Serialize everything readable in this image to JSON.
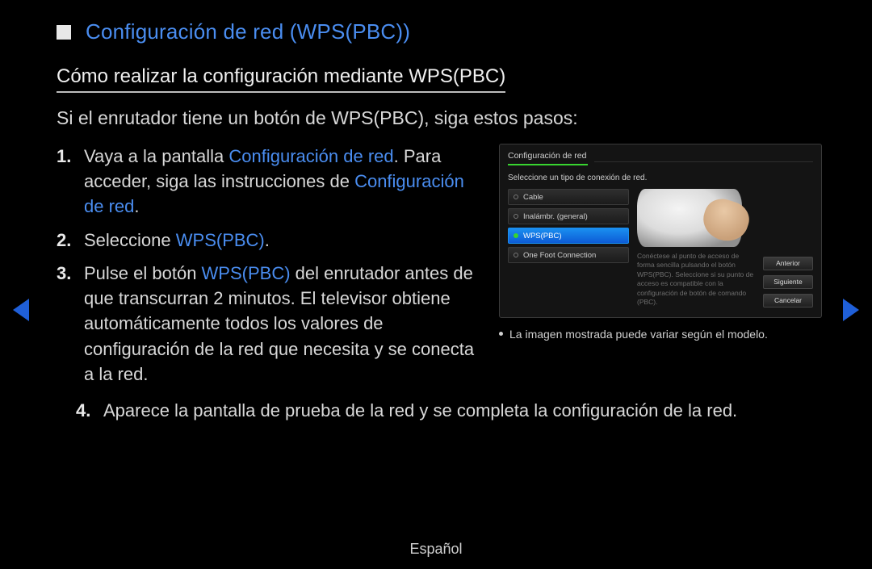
{
  "title": {
    "prefix": "Configuración de red (",
    "emph": "WPS(PBC)",
    "suffix": ")"
  },
  "subtitle": "Cómo realizar la configuración mediante WPS(PBC)",
  "intro": "Si el enrutador tiene un botón de WPS(PBC), siga estos pasos:",
  "steps": {
    "s1": {
      "num": "1.",
      "t1": "Vaya a la pantalla ",
      "e1": "Configuración de red",
      "t2": ". Para acceder, siga las instrucciones de ",
      "e2": "Configuración de red",
      "t3": "."
    },
    "s2": {
      "num": "2.",
      "t1": "Seleccione ",
      "e1": "WPS(PBC)",
      "t2": "."
    },
    "s3": {
      "num": "3.",
      "t1": "Pulse el botón ",
      "e1": "WPS(PBC)",
      "t2": " del enrutador antes de que transcurran 2 minutos. El televisor obtiene automáticamente todos los valores de configuración de la red que necesita y se conecta a la red."
    },
    "s4": {
      "num": "4.",
      "t1": "Aparece la pantalla de prueba de la red y se completa la configuración de la red."
    }
  },
  "panel": {
    "header_tab": "Configuración de red",
    "sub": "Seleccione un tipo de conexión de red.",
    "options": [
      "Cable",
      "Inalámbr. (general)",
      "WPS(PBC)",
      "One Foot Connection"
    ],
    "selected_index": 2,
    "desc": "Conéctese al punto de acceso de forma sencilla pulsando el botón WPS(PBC). Seleccione si su punto de acceso es compatible con la configuración de botón de comando (PBC).",
    "buttons": [
      "Anterior",
      "Siguiente",
      "Cancelar"
    ]
  },
  "caption": "La imagen mostrada puede variar según el modelo.",
  "footer": "Español"
}
